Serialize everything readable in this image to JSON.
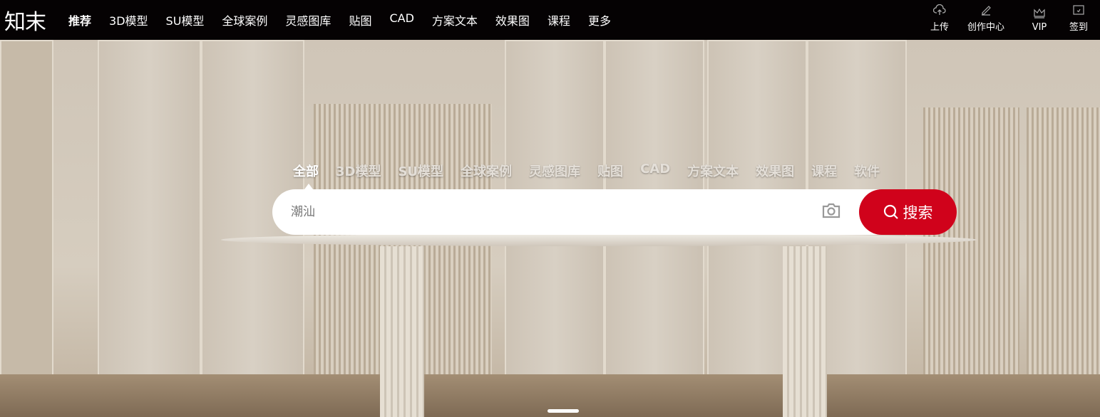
{
  "header": {
    "logo": "知末",
    "nav": [
      "推荐",
      "3D模型",
      "SU模型",
      "全球案例",
      "灵感图库",
      "贴图",
      "CAD",
      "方案文本",
      "效果图",
      "课程",
      "更多"
    ],
    "actions": [
      {
        "label": "上传",
        "icon": "cloud-upload-icon"
      },
      {
        "label": "创作中心",
        "icon": "pen-icon"
      },
      {
        "label": "VIP",
        "icon": "crown-icon"
      },
      {
        "label": "签到",
        "icon": "calendar-check-icon"
      }
    ]
  },
  "search": {
    "tabs": [
      "全部",
      "3D模型",
      "SU模型",
      "全球案例",
      "灵感图库",
      "贴图",
      "CAD",
      "方案文本",
      "效果图",
      "课程",
      "软件"
    ],
    "active_tab": "全部",
    "placeholder": "潮汕",
    "button_label": "搜索",
    "button_color": "#d0021b"
  }
}
